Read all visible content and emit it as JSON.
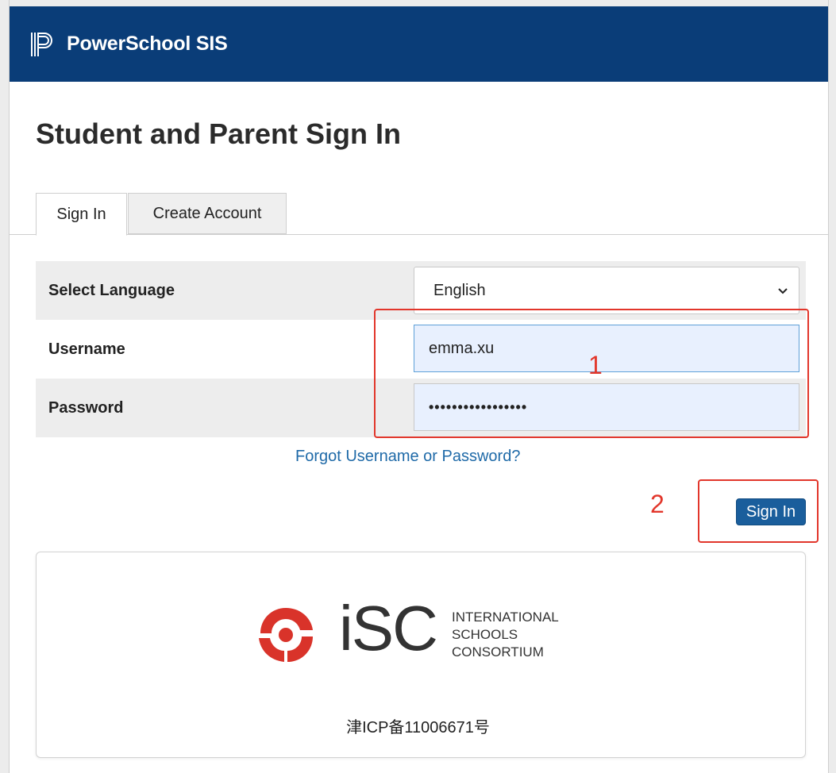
{
  "header": {
    "app_title": "PowerSchool SIS",
    "logo_icon": "powerschool-logo-icon",
    "bg_color": "#0a3d78"
  },
  "page": {
    "title": "Student and Parent Sign In"
  },
  "tabs": [
    {
      "label": "Sign In",
      "active": true
    },
    {
      "label": "Create Account",
      "active": false
    }
  ],
  "form": {
    "language": {
      "label": "Select Language",
      "selected": "English"
    },
    "username": {
      "label": "Username",
      "value": "emma.xu"
    },
    "password": {
      "label": "Password",
      "value": "•••••••••••••••••"
    },
    "forgot_link": "Forgot Username or Password?",
    "submit_label": "Sign In",
    "submit_color": "#1a5e9c"
  },
  "annotations": [
    {
      "number": "1",
      "color": "#e2362b"
    },
    {
      "number": "2",
      "color": "#e2362b"
    }
  ],
  "branding": {
    "letters": "iSC",
    "org_lines": [
      "INTERNATIONAL",
      "SCHOOLS",
      "CONSORTIUM"
    ],
    "icp": "津ICP备11006671号",
    "logo_color": "#d9332a"
  }
}
